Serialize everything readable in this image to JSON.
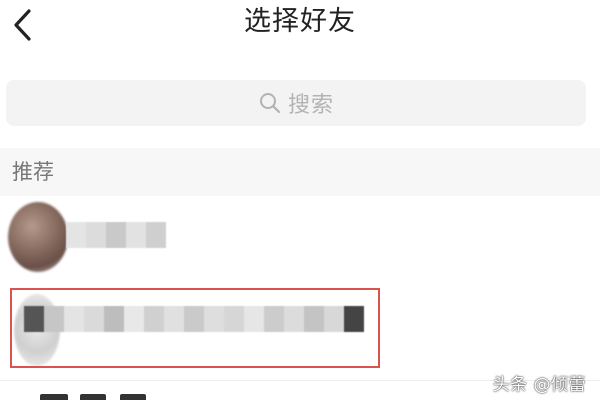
{
  "header": {
    "title": "选择好友",
    "back_icon": "chevron-left-icon"
  },
  "search": {
    "placeholder": "搜索",
    "icon": "search-icon"
  },
  "section": {
    "label": "推荐"
  },
  "friends": [
    {
      "name_obscured": true,
      "mosaic": [
        "#e4e4e4",
        "#dcdcdc",
        "#c9c9c9",
        "#e2e2e2",
        "#cfcfcf"
      ]
    },
    {
      "name_obscured": true,
      "mosaic": [
        "#555555",
        "#c6c6c6",
        "#e4e4e4",
        "#dadada",
        "#bdbdbd",
        "#e8e8e8",
        "#d0d0d0",
        "#e0e0e0",
        "#cacaca",
        "#dedede",
        "#d6d6d6",
        "#e6e6e6",
        "#cccccc",
        "#dcdcdc",
        "#c4c4c4",
        "#d8d8d8",
        "#444444"
      ]
    }
  ],
  "highlight_color": "#d9534f",
  "watermark": "头条 @倾蕾"
}
